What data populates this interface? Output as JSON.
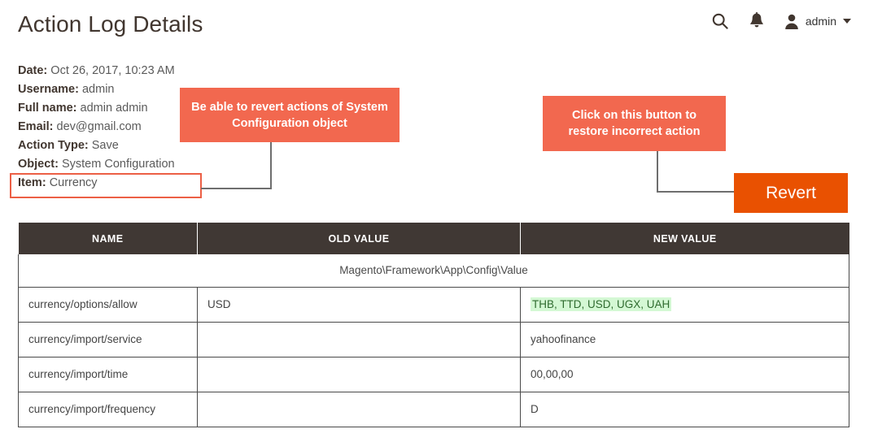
{
  "header": {
    "title": "Action Log Details",
    "search_icon": "search-icon",
    "notification_icon": "bell-icon",
    "avatar_icon": "user-avatar-icon",
    "admin_label": "admin",
    "chevron_icon": "chevron-down-icon"
  },
  "details": [
    {
      "label": "Date:",
      "value": "Oct 26, 2017, 10:23 AM"
    },
    {
      "label": "Username:",
      "value": "admin"
    },
    {
      "label": "Full name:",
      "value": "admin admin"
    },
    {
      "label": "Email:",
      "value": "dev@gmail.com"
    },
    {
      "label": "Action Type:",
      "value": "Save"
    },
    {
      "label": "Object:",
      "value": "System Configuration"
    },
    {
      "label": "Item:",
      "value": "Currency"
    }
  ],
  "callouts": {
    "object": "Be able to revert actions of System Configuration object",
    "revert": "Click on this button to restore incorrect action"
  },
  "revert_button": {
    "label": "Revert"
  },
  "table": {
    "columns": [
      "NAME",
      "OLD VALUE",
      "NEW VALUE"
    ],
    "group_row": "Magento\\Framework\\App\\Config\\Value",
    "rows": [
      {
        "name": "currency/options/allow",
        "old": "USD",
        "new": "THB, TTD, USD, UGX, UAH",
        "new_highlight": true
      },
      {
        "name": "currency/import/service",
        "old": "",
        "new": "yahoofinance",
        "new_highlight": false
      },
      {
        "name": "currency/import/time",
        "old": "",
        "new": "00,00,00",
        "new_highlight": false
      },
      {
        "name": "currency/import/frequency",
        "old": "",
        "new": "D",
        "new_highlight": false
      }
    ]
  },
  "colors": {
    "callout_bg": "#f2684f",
    "highlight_border": "#ec5f45",
    "revert_bg": "#e95101",
    "table_header_bg": "#403834",
    "new_value_highlight_bg": "#d4f8d4",
    "new_value_highlight_text": "#2f6b2f"
  }
}
